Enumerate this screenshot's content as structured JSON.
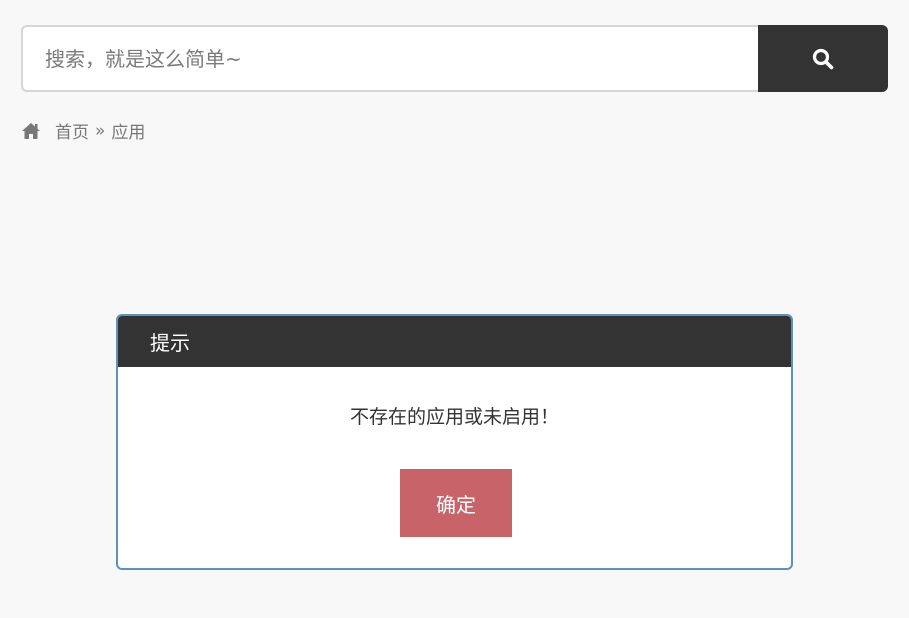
{
  "search": {
    "placeholder": "搜索，就是这么简单~",
    "button_icon": "search-icon"
  },
  "breadcrumb": {
    "home_icon": "home-icon",
    "home_label": "首页",
    "separator": "»",
    "current": "应用"
  },
  "modal": {
    "title": "提示",
    "message": "不存在的应用或未启用！",
    "confirm_label": "确定"
  },
  "colors": {
    "dark": "#333333",
    "confirm": "#c9636a",
    "modal_border": "#5b93bd",
    "background": "#f8f8f8"
  }
}
